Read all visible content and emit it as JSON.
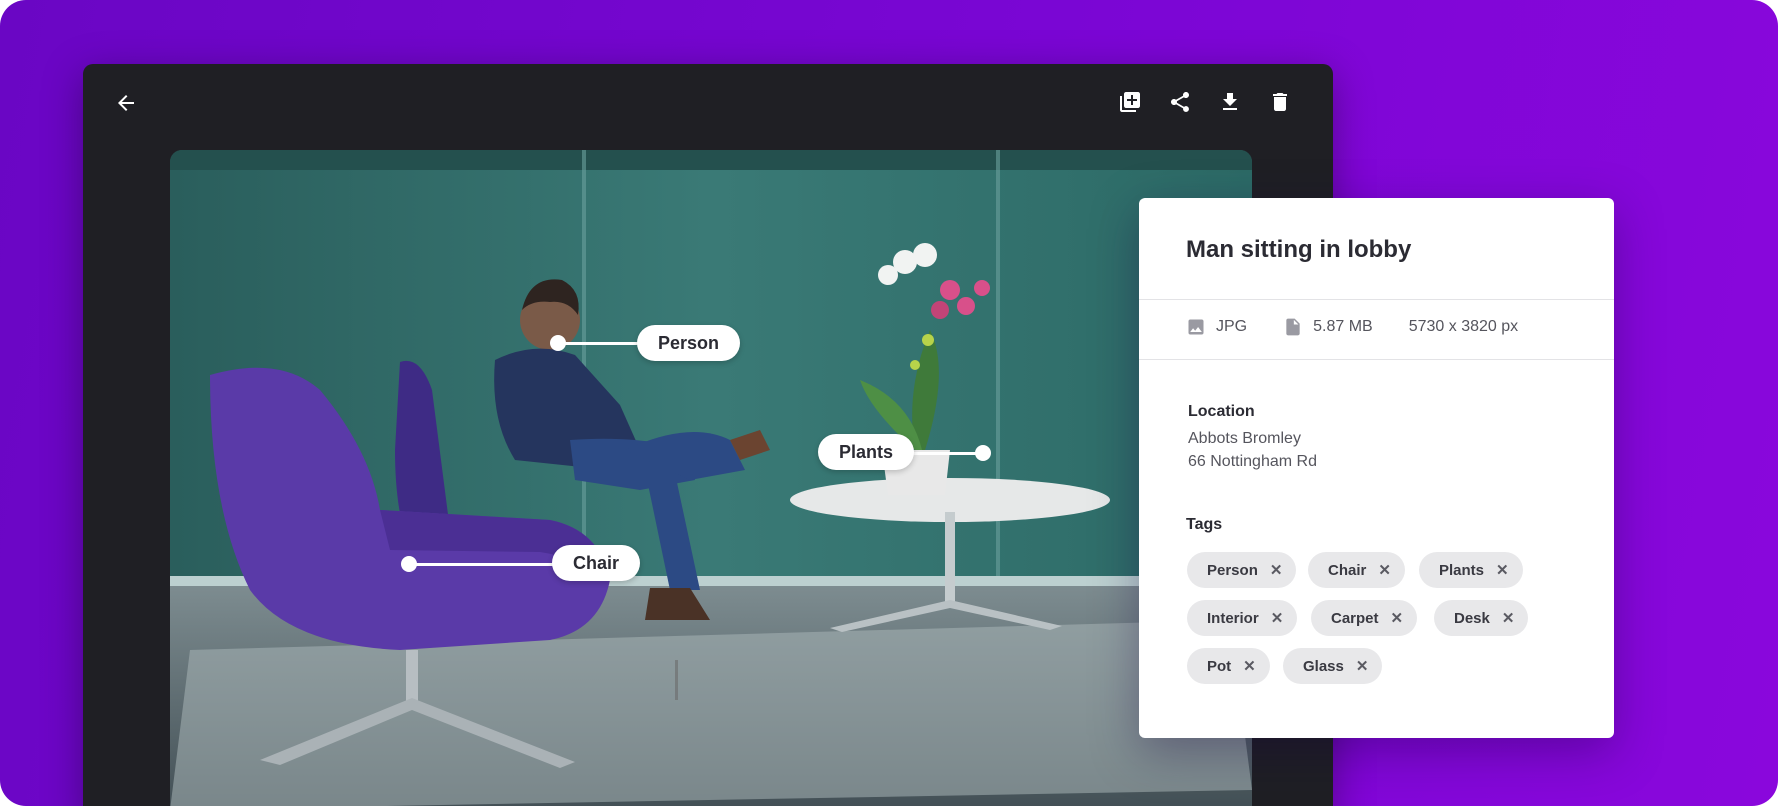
{
  "toolbar": {
    "back_icon": "arrow-left-icon",
    "actions": [
      "add-to-collection-icon",
      "share-icon",
      "download-icon",
      "delete-icon"
    ]
  },
  "image_labels": {
    "person": "Person",
    "plants": "Plants",
    "chair": "Chair"
  },
  "details": {
    "title": "Man sitting in lobby",
    "file_type": "JPG",
    "file_size": "5.87 MB",
    "dimensions": "5730 x 3820 px",
    "location_label": "Location",
    "location_line1": "Abbots Bromley",
    "location_line2": "66 Nottingham Rd",
    "tags_label": "Tags",
    "tags": [
      "Person",
      "Chair",
      "Plants",
      "Interior",
      "Carpet",
      "Desk",
      "Pot",
      "Glass"
    ],
    "remove_glyph": "✕"
  },
  "colors": {
    "background_gradient_start": "#6a06c4",
    "background_gradient_end": "#8a07dc",
    "viewer_bg": "#1f1f24",
    "chair_purple": "#5a3aa8",
    "wall_teal": "#2f6b68"
  }
}
